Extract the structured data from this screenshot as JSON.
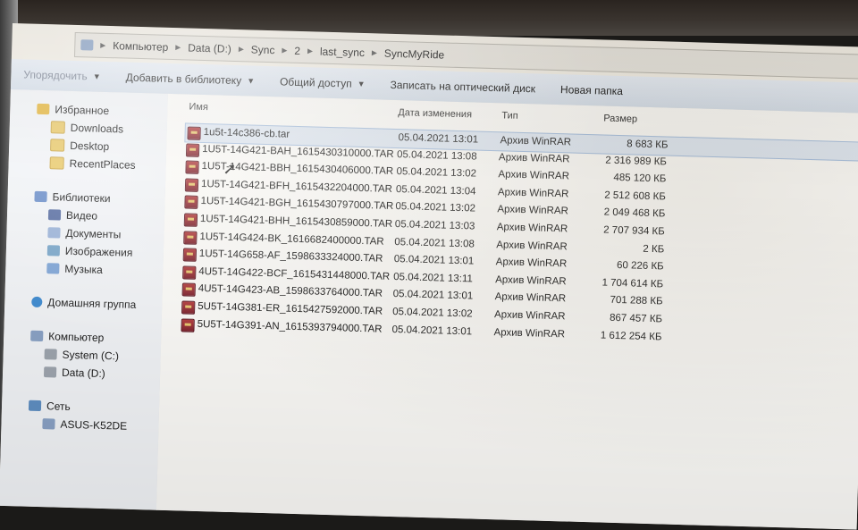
{
  "breadcrumb": [
    "Компьютер",
    "Data (D:)",
    "Sync",
    "2",
    "last_sync",
    "SyncMyRide"
  ],
  "toolbar": {
    "organize": "Упорядочить",
    "add_to_library": "Добавить в библиотеку",
    "share": "Общий доступ",
    "burn": "Записать на оптический диск",
    "new_folder": "Новая папка"
  },
  "nav": {
    "favorites": "Избранное",
    "downloads": "Downloads",
    "desktop": "Desktop",
    "recent": "RecentPlaces",
    "libraries": "Библиотеки",
    "video": "Видео",
    "documents": "Документы",
    "images": "Изображения",
    "music": "Музыка",
    "homegroup": "Домашняя группа",
    "computer": "Компьютер",
    "system_c": "System (C:)",
    "data_d": "Data (D:)",
    "network": "Сеть",
    "asus": "ASUS-K52DE"
  },
  "columns": {
    "name": "Имя",
    "date": "Дата изменения",
    "type": "Тип",
    "size": "Размер"
  },
  "files": [
    {
      "name": "1u5t-14c386-cb.tar",
      "date": "05.04.2021 13:01",
      "type": "Архив WinRAR",
      "size": "8 683 КБ"
    },
    {
      "name": "1U5T-14G421-BAH_1615430310000.TAR",
      "date": "05.04.2021 13:08",
      "type": "Архив WinRAR",
      "size": "2 316 989 КБ"
    },
    {
      "name": "1U5T-14G421-BBH_1615430406000.TAR",
      "date": "05.04.2021 13:02",
      "type": "Архив WinRAR",
      "size": "485 120 КБ"
    },
    {
      "name": "1U5T-14G421-BFH_1615432204000.TAR",
      "date": "05.04.2021 13:04",
      "type": "Архив WinRAR",
      "size": "2 512 608 КБ"
    },
    {
      "name": "1U5T-14G421-BGH_1615430797000.TAR",
      "date": "05.04.2021 13:02",
      "type": "Архив WinRAR",
      "size": "2 049 468 КБ"
    },
    {
      "name": "1U5T-14G421-BHH_1615430859000.TAR",
      "date": "05.04.2021 13:03",
      "type": "Архив WinRAR",
      "size": "2 707 934 КБ"
    },
    {
      "name": "1U5T-14G424-BK_1616682400000.TAR",
      "date": "05.04.2021 13:08",
      "type": "Архив WinRAR",
      "size": "2 КБ"
    },
    {
      "name": "1U5T-14G658-AF_1598633324000.TAR",
      "date": "05.04.2021 13:01",
      "type": "Архив WinRAR",
      "size": "60 226 КБ"
    },
    {
      "name": "4U5T-14G422-BCF_1615431448000.TAR",
      "date": "05.04.2021 13:11",
      "type": "Архив WinRAR",
      "size": "1 704 614 КБ"
    },
    {
      "name": "4U5T-14G423-AB_1598633764000.TAR",
      "date": "05.04.2021 13:01",
      "type": "Архив WinRAR",
      "size": "701 288 КБ"
    },
    {
      "name": "5U5T-14G381-ER_1615427592000.TAR",
      "date": "05.04.2021 13:02",
      "type": "Архив WinRAR",
      "size": "867 457 КБ"
    },
    {
      "name": "5U5T-14G391-AN_1615393794000.TAR",
      "date": "05.04.2021 13:01",
      "type": "Архив WinRAR",
      "size": "1 612 254 КБ"
    }
  ]
}
